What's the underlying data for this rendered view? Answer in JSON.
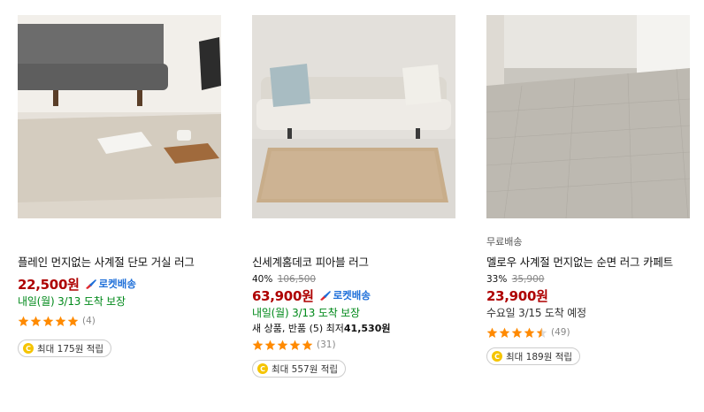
{
  "products": [
    {
      "title": "플레인 먼지없는 사계절 단모 거실 러그",
      "discount_rate": "",
      "original_price": "",
      "price": "22,500원",
      "rocket_label": "로켓배송",
      "delivery": "내일(월) 3/13 도착 보장",
      "offer": "",
      "rating": 5,
      "review_count": "(4)",
      "reward": "최대 175원 적립",
      "free_shipping": ""
    },
    {
      "title": "신세계홈데코 피아블 러그",
      "discount_rate": "40%",
      "original_price": "106,500",
      "price": "63,900원",
      "rocket_label": "로켓배송",
      "delivery": "내일(월) 3/13 도착 보장",
      "offer_prefix": "새 상품, 반품 (5) 최저",
      "offer_price": "41,530원",
      "rating": 5,
      "review_count": "(31)",
      "reward": "최대 557원 적립",
      "free_shipping": ""
    },
    {
      "title": "멜로우 사계절 먼지없는 순면 러그 카페트",
      "discount_rate": "33%",
      "original_price": "35,900",
      "price": "23,900원",
      "rocket_label": "",
      "delivery": "수요일 3/15 도착 예정",
      "offer": "",
      "rating": 4.5,
      "review_count": "(49)",
      "reward": "최대 189원 적립",
      "free_shipping": "무료배송"
    }
  ],
  "colors": {
    "price": "#ae0000",
    "rocket": "#1e6fd9",
    "delivery_guaranteed": "#00891a",
    "star": "#ff8a00",
    "coin": "#f5c400"
  },
  "icons": {
    "rocket": "rocket-icon",
    "star": "star-icon",
    "coin": "coin-icon"
  }
}
